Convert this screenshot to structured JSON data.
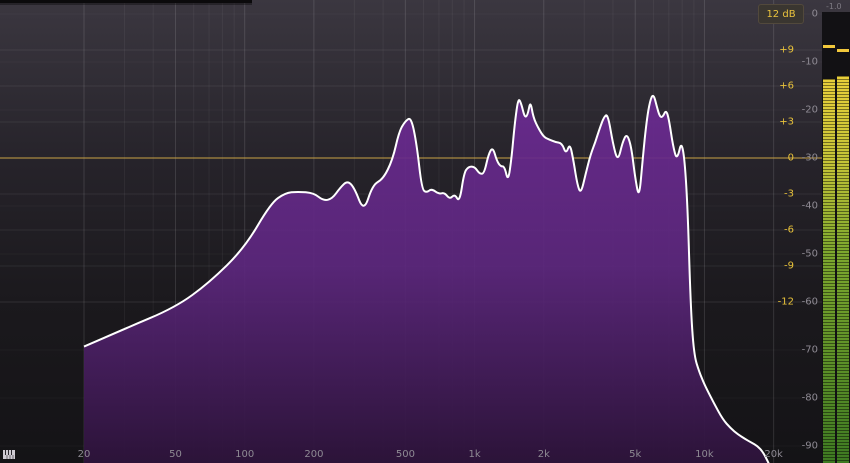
{
  "range_button": {
    "label": "12 dB"
  },
  "frequency_axis": {
    "labels": [
      {
        "text": "20",
        "hz": 20
      },
      {
        "text": "50",
        "hz": 50
      },
      {
        "text": "100",
        "hz": 100
      },
      {
        "text": "200",
        "hz": 200
      },
      {
        "text": "500",
        "hz": 500
      },
      {
        "text": "1k",
        "hz": 1000
      },
      {
        "text": "2k",
        "hz": 2000
      },
      {
        "text": "5k",
        "hz": 5000
      },
      {
        "text": "10k",
        "hz": 10000
      },
      {
        "text": "20k",
        "hz": 20000
      }
    ]
  },
  "gain_scale": {
    "labels": [
      {
        "text": "+9",
        "value": 9
      },
      {
        "text": "+6",
        "value": 6
      },
      {
        "text": "+3",
        "value": 3
      },
      {
        "text": "0",
        "value": 0
      },
      {
        "text": "-3",
        "value": -3
      },
      {
        "text": "-6",
        "value": -6
      },
      {
        "text": "-9",
        "value": -9
      },
      {
        "text": "-12",
        "value": -12
      }
    ]
  },
  "db_scale": {
    "labels": [
      {
        "text": "0",
        "value": 0
      },
      {
        "text": "-10",
        "value": -10
      },
      {
        "text": "-20",
        "value": -20
      },
      {
        "text": "-30",
        "value": -30
      },
      {
        "text": "-40",
        "value": -40
      },
      {
        "text": "-50",
        "value": -50
      },
      {
        "text": "-60",
        "value": -60
      },
      {
        "text": "-70",
        "value": -70
      },
      {
        "text": "-80",
        "value": -80
      },
      {
        "text": "-90",
        "value": -90
      }
    ]
  },
  "level_meter": {
    "peak_readout": "-1.0",
    "left_level_db": -13.5,
    "right_level_db": -13.0,
    "left_peak_db": -6.5,
    "right_peak_db": -7.3
  },
  "spectrum": {
    "fill_color": "#5e2780",
    "line_color": "#ffffff",
    "zero_line_color": "#c9a040",
    "points": [
      [
        20,
        -69.3
      ],
      [
        30,
        -65.6
      ],
      [
        50,
        -61.1
      ],
      [
        70,
        -56.0
      ],
      [
        100,
        -48.7
      ],
      [
        130,
        -39.4
      ],
      [
        150,
        -37.3
      ],
      [
        170,
        -37.0
      ],
      [
        200,
        -37.3
      ],
      [
        220,
        -38.9
      ],
      [
        240,
        -38.5
      ],
      [
        260,
        -36.2
      ],
      [
        280,
        -34.7
      ],
      [
        300,
        -36.2
      ],
      [
        330,
        -41.3
      ],
      [
        360,
        -35.6
      ],
      [
        400,
        -34.4
      ],
      [
        440,
        -30.4
      ],
      [
        470,
        -24.4
      ],
      [
        500,
        -22.3
      ],
      [
        530,
        -21.5
      ],
      [
        560,
        -27.1
      ],
      [
        590,
        -36.6
      ],
      [
        620,
        -37.2
      ],
      [
        650,
        -36.4
      ],
      [
        700,
        -37.5
      ],
      [
        740,
        -37.2
      ],
      [
        780,
        -38.6
      ],
      [
        820,
        -37.5
      ],
      [
        860,
        -39.3
      ],
      [
        900,
        -33.1
      ],
      [
        940,
        -31.8
      ],
      [
        1000,
        -31.8
      ],
      [
        1050,
        -33.3
      ],
      [
        1100,
        -33.3
      ],
      [
        1150,
        -29.2
      ],
      [
        1200,
        -27.7
      ],
      [
        1250,
        -30.6
      ],
      [
        1300,
        -31.8
      ],
      [
        1350,
        -31.7
      ],
      [
        1400,
        -35.0
      ],
      [
        1450,
        -29.8
      ],
      [
        1500,
        -22.3
      ],
      [
        1550,
        -17.4
      ],
      [
        1600,
        -18.8
      ],
      [
        1650,
        -21.5
      ],
      [
        1700,
        -21.2
      ],
      [
        1750,
        -18.0
      ],
      [
        1800,
        -21.5
      ],
      [
        1900,
        -23.9
      ],
      [
        2000,
        -25.6
      ],
      [
        2100,
        -26.1
      ],
      [
        2250,
        -26.7
      ],
      [
        2400,
        -26.9
      ],
      [
        2500,
        -29.2
      ],
      [
        2600,
        -26.9
      ],
      [
        2700,
        -30.8
      ],
      [
        2800,
        -35.6
      ],
      [
        2900,
        -37.5
      ],
      [
        3050,
        -33.1
      ],
      [
        3200,
        -29.2
      ],
      [
        3350,
        -26.7
      ],
      [
        3500,
        -23.9
      ],
      [
        3650,
        -21.5
      ],
      [
        3800,
        -20.8
      ],
      [
        4000,
        -27.1
      ],
      [
        4200,
        -30.8
      ],
      [
        4400,
        -26.7
      ],
      [
        4600,
        -24.9
      ],
      [
        4800,
        -27.5
      ],
      [
        5000,
        -34.2
      ],
      [
        5200,
        -38.6
      ],
      [
        5400,
        -29.8
      ],
      [
        5600,
        -22.3
      ],
      [
        5800,
        -18.0
      ],
      [
        6000,
        -16.6
      ],
      [
        6200,
        -19.2
      ],
      [
        6400,
        -21.5
      ],
      [
        6600,
        -21.4
      ],
      [
        6800,
        -20.0
      ],
      [
        7000,
        -21.7
      ],
      [
        7300,
        -27.5
      ],
      [
        7600,
        -30.6
      ],
      [
        8000,
        -25.8
      ],
      [
        8400,
        -36.4
      ],
      [
        8700,
        -60.3
      ],
      [
        9000,
        -71.0
      ],
      [
        9500,
        -74.6
      ],
      [
        10000,
        -77.2
      ],
      [
        11000,
        -81.1
      ],
      [
        12000,
        -84.4
      ],
      [
        13000,
        -86.3
      ],
      [
        14000,
        -87.6
      ],
      [
        15000,
        -88.5
      ],
      [
        16000,
        -89.3
      ],
      [
        17000,
        -90.0
      ],
      [
        18000,
        -91.3
      ],
      [
        19000,
        -93.5
      ],
      [
        20000,
        -96.0
      ]
    ]
  }
}
